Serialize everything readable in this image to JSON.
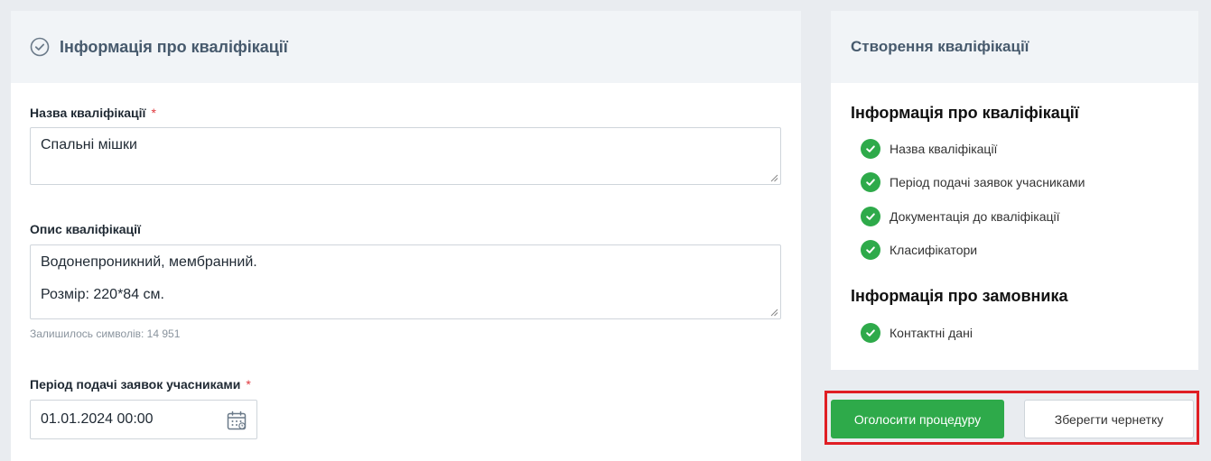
{
  "left_panel": {
    "title": "Інформація про кваліфікації",
    "name_field": {
      "label": "Назва кваліфікації",
      "required_mark": "*",
      "value": "Спальні мішки"
    },
    "description_field": {
      "label": "Опис кваліфікації",
      "line1": "Водонепроникний, мембранний.",
      "line2": "Розмір: 220*84 см.",
      "chars_left": "Залишилось символів: 14 951"
    },
    "period_field": {
      "label": "Період подачі заявок учасниками",
      "required_mark": "*",
      "value": "01.01.2024 00:00"
    }
  },
  "right_panel": {
    "title": "Створення кваліфікації",
    "section_info": {
      "title": "Інформація про кваліфікації",
      "steps": [
        "Назва кваліфікації",
        "Період подачі заявок учасниками",
        "Документація до кваліфікації",
        "Класифікатори"
      ]
    },
    "section_customer": {
      "title": "Інформація про замовника",
      "steps": [
        "Контактні дані"
      ]
    }
  },
  "actions": {
    "announce_label": "Оголосити процедуру",
    "save_draft_label": "Зберегти чернетку"
  },
  "colors": {
    "accent_green": "#2eaa4a",
    "highlight_red": "#e01e24",
    "header_bg": "#f1f4f7",
    "heading_text": "#475a6d"
  }
}
